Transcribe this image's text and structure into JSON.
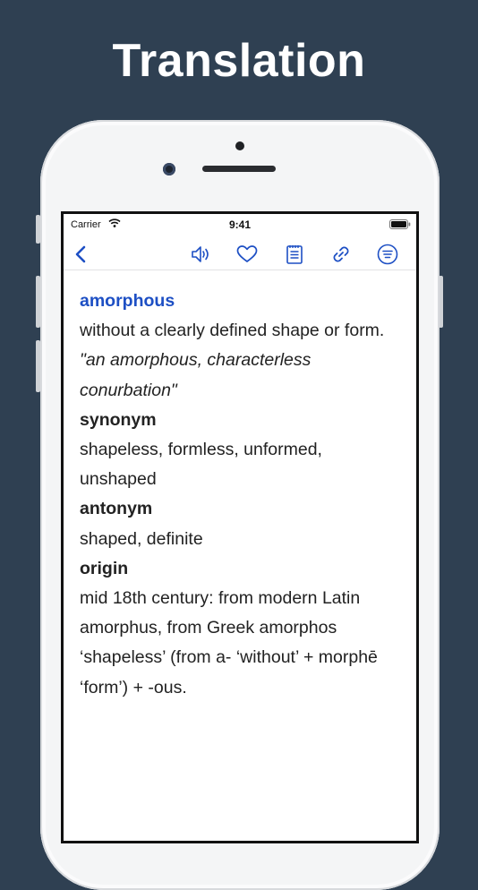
{
  "headline": "Translation",
  "status": {
    "carrier": "Carrier",
    "time": "9:41"
  },
  "toolbar": {
    "icons": [
      "back-icon",
      "speaker-icon",
      "heart-icon",
      "notes-icon",
      "link-icon",
      "menu-icon"
    ]
  },
  "entry": {
    "word": "amorphous",
    "definition": "without a clearly defined shape or form.",
    "example": "\"an amorphous, characterless conurbation\"",
    "synonym_label": "synonym",
    "synonyms": "shapeless, formless, unformed, unshaped",
    "antonym_label": "antonym",
    "antonyms": "shaped, definite",
    "origin_label": "origin",
    "origin": "mid 18th century: from modern Latin amorphus, from Greek amorphos ‘shapeless’ (from a- ‘without’ + morphē ‘form’) + -ous."
  },
  "colors": {
    "background": "#2f4052",
    "accent": "#1d4fc4"
  }
}
